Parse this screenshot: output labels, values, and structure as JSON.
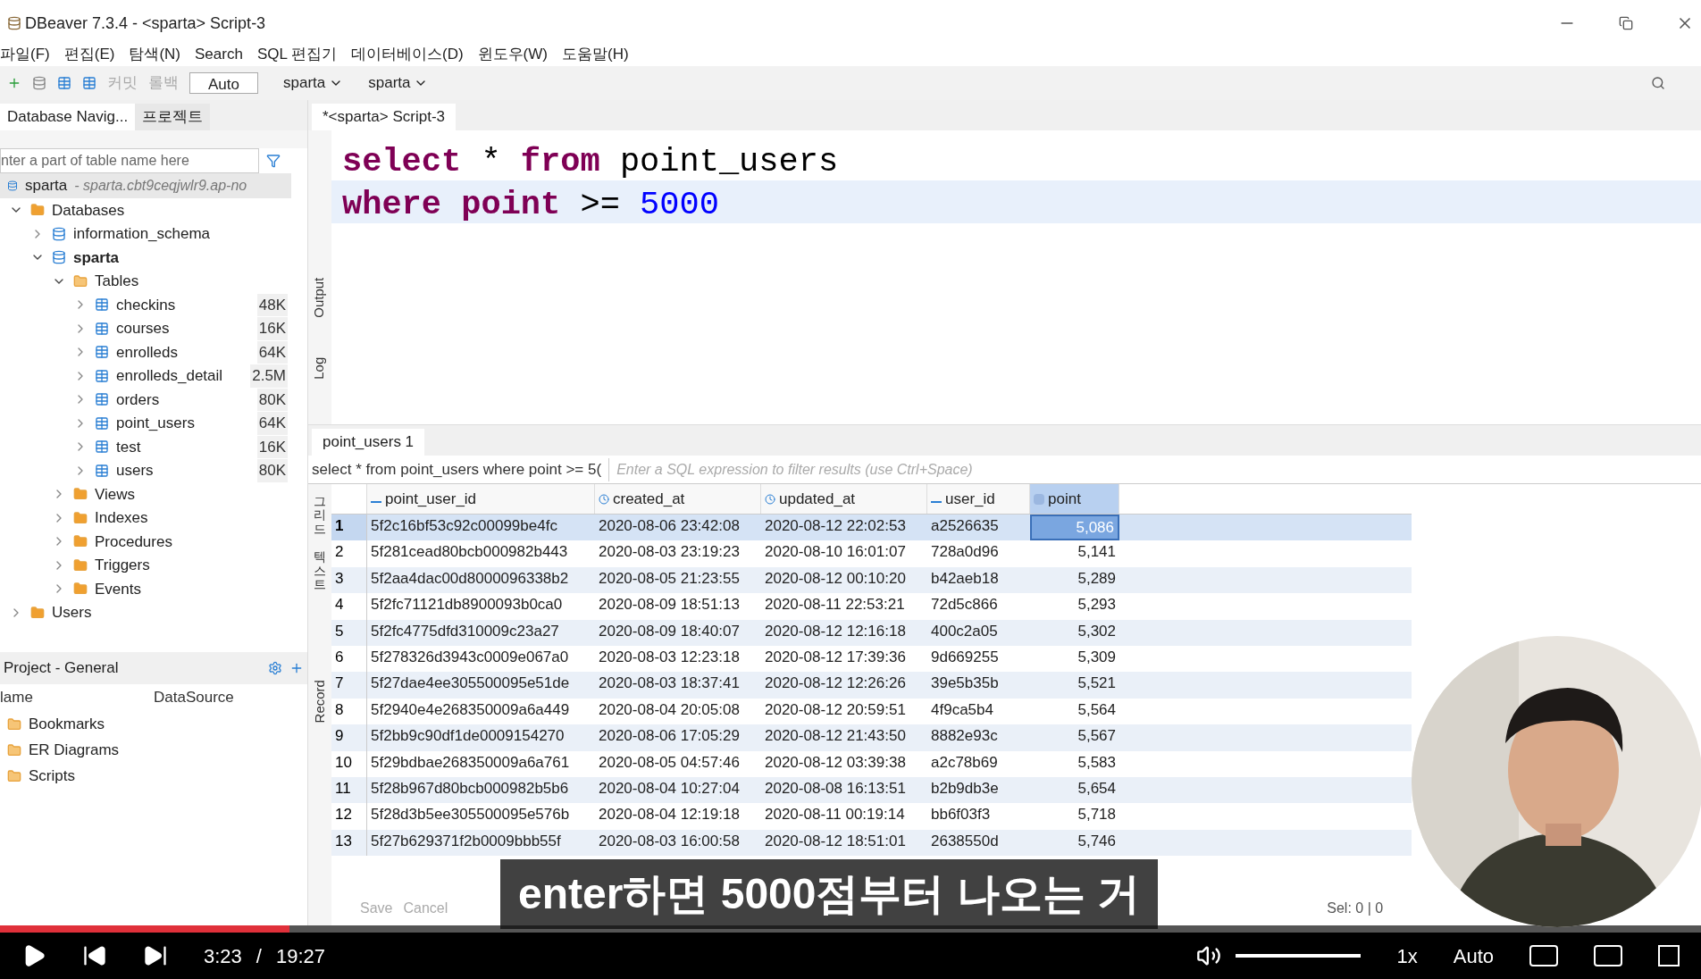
{
  "window": {
    "title": "DBeaver 7.3.4 - <sparta> Script-3"
  },
  "menu": [
    "파일(F)",
    "편집(E)",
    "탐색(N)",
    "Search",
    "SQL 편집기",
    "데이터베이스(D)",
    "윈도우(W)",
    "도움말(H)"
  ],
  "toolbar": {
    "commit": "커밋",
    "rollback": "롤백",
    "transaction_mode": "Auto",
    "datasource": "sparta",
    "schema": "sparta"
  },
  "navigator": {
    "tabs": [
      {
        "label": "Database Navig...",
        "selected": true
      },
      {
        "label": "프로젝트",
        "selected": false
      }
    ],
    "filter_placeholder": "nter a part of table name here",
    "connection": {
      "name": "sparta",
      "host": "- sparta.cbt9ceqjwlr9.ap-no"
    },
    "tree": [
      {
        "label": "Databases",
        "kind": "folder",
        "expanded": true,
        "children": [
          {
            "label": "information_schema",
            "kind": "db",
            "expanded": false
          },
          {
            "label": "sparta",
            "kind": "db",
            "expanded": true,
            "bold": true,
            "children": [
              {
                "label": "Tables",
                "kind": "tables",
                "expanded": true,
                "children": [
                  {
                    "label": "checkins",
                    "kind": "table",
                    "size": "48K",
                    "expanded": false
                  },
                  {
                    "label": "courses",
                    "kind": "table",
                    "size": "16K",
                    "expanded": false
                  },
                  {
                    "label": "enrolleds",
                    "kind": "table",
                    "size": "64K",
                    "expanded": false
                  },
                  {
                    "label": "enrolleds_detail",
                    "kind": "table",
                    "size": "2.5M",
                    "expanded": false
                  },
                  {
                    "label": "orders",
                    "kind": "table",
                    "size": "80K",
                    "expanded": false
                  },
                  {
                    "label": "point_users",
                    "kind": "table",
                    "size": "64K",
                    "expanded": false
                  },
                  {
                    "label": "test",
                    "kind": "table",
                    "size": "16K",
                    "expanded": false
                  },
                  {
                    "label": "users",
                    "kind": "table",
                    "size": "80K",
                    "expanded": false
                  }
                ]
              },
              {
                "label": "Views",
                "kind": "folder",
                "expanded": false
              },
              {
                "label": "Indexes",
                "kind": "folder",
                "expanded": false
              },
              {
                "label": "Procedures",
                "kind": "folder",
                "expanded": false
              },
              {
                "label": "Triggers",
                "kind": "folder",
                "expanded": false
              },
              {
                "label": "Events",
                "kind": "folder",
                "expanded": false
              }
            ]
          }
        ]
      },
      {
        "label": "Users",
        "kind": "folder",
        "expanded": false
      }
    ]
  },
  "project": {
    "title": "Project - General",
    "columns": [
      "lame",
      "DataSource"
    ],
    "items": [
      "Bookmarks",
      "ER Diagrams",
      "Scripts"
    ]
  },
  "editor": {
    "tab": "*<sparta> Script-3",
    "side_tabs": [
      "Output",
      "Log"
    ],
    "lines": [
      {
        "current": false,
        "tokens": [
          {
            "kind": "keyword",
            "text": "select"
          },
          {
            "kind": "plain",
            "text": " * "
          },
          {
            "kind": "keyword",
            "text": "from"
          },
          {
            "kind": "plain",
            "text": " point_users"
          }
        ]
      },
      {
        "current": true,
        "tokens": [
          {
            "kind": "keyword",
            "text": "where point"
          },
          {
            "kind": "plain",
            "text": " >= "
          },
          {
            "kind": "number",
            "text": "5000"
          }
        ]
      }
    ]
  },
  "results": {
    "tab": "point_users 1",
    "query": "select * from point_users where point >= 5(",
    "filter_placeholder": "Enter a SQL expression to filter results (use Ctrl+Space)",
    "side_tabs": [
      "그리드",
      "텍스트",
      "Record"
    ],
    "columns": [
      {
        "name": "point_user_id",
        "kind": "text",
        "selected": false
      },
      {
        "name": "created_at",
        "kind": "time",
        "selected": false
      },
      {
        "name": "updated_at",
        "kind": "time",
        "selected": false
      },
      {
        "name": "user_id",
        "kind": "text",
        "selected": false
      },
      {
        "name": "point",
        "kind": "number",
        "selected": true
      }
    ],
    "rows": [
      {
        "n": "1",
        "selected": true,
        "cells": [
          "5f2c16bf53c92c00099be4fc",
          "2020-08-06 23:42:08",
          "2020-08-12 22:02:53",
          "a2526635",
          "5,086"
        ]
      },
      {
        "n": "2",
        "selected": false,
        "cells": [
          "5f281cead80bcb000982b443",
          "2020-08-03 23:19:23",
          "2020-08-10 16:01:07",
          "728a0d96",
          "5,141"
        ]
      },
      {
        "n": "3",
        "selected": false,
        "cells": [
          "5f2aa4dac00d8000096338b2",
          "2020-08-05 21:23:55",
          "2020-08-12 00:10:20",
          "b42aeb18",
          "5,289"
        ]
      },
      {
        "n": "4",
        "selected": false,
        "cells": [
          "5f2fc71121db8900093b0ca0",
          "2020-08-09 18:51:13",
          "2020-08-11 22:53:21",
          "72d5c866",
          "5,293"
        ]
      },
      {
        "n": "5",
        "selected": false,
        "cells": [
          "5f2fc4775dfd310009c23a27",
          "2020-08-09 18:40:07",
          "2020-08-12 12:16:18",
          "400c2a05",
          "5,302"
        ]
      },
      {
        "n": "6",
        "selected": false,
        "cells": [
          "5f278326d3943c0009e067a0",
          "2020-08-03 12:23:18",
          "2020-08-12 17:39:36",
          "9d669255",
          "5,309"
        ]
      },
      {
        "n": "7",
        "selected": false,
        "cells": [
          "5f27dae4ee305500095e51de",
          "2020-08-03 18:37:41",
          "2020-08-12 12:26:26",
          "39e5b35b",
          "5,521"
        ]
      },
      {
        "n": "8",
        "selected": false,
        "cells": [
          "5f2940e4e268350009a6a449",
          "2020-08-04 20:05:08",
          "2020-08-12 20:59:51",
          "4f9ca5b4",
          "5,564"
        ]
      },
      {
        "n": "9",
        "selected": false,
        "cells": [
          "5f2bb9c90df1de0009154270",
          "2020-08-06 17:05:29",
          "2020-08-12 21:43:50",
          "8882e93c",
          "5,567"
        ]
      },
      {
        "n": "10",
        "selected": false,
        "cells": [
          "5f29bdbae268350009a6a761",
          "2020-08-05 04:57:46",
          "2020-08-12 03:39:38",
          "a2c78b69",
          "5,583"
        ]
      },
      {
        "n": "11",
        "selected": false,
        "cells": [
          "5f28b967d80bcb000982b5b6",
          "2020-08-04 10:27:04",
          "2020-08-08 16:13:51",
          "b2b9db3e",
          "5,654"
        ]
      },
      {
        "n": "12",
        "selected": false,
        "cells": [
          "5f28d3b5ee305500095e576b",
          "2020-08-04 12:19:18",
          "2020-08-11 00:19:14",
          "bb6f03f3",
          "5,718"
        ]
      },
      {
        "n": "13",
        "selected": false,
        "cells": [
          "5f27b629371f2b0009bbb55f",
          "2020-08-03 16:00:58",
          "2020-08-12 18:51:01",
          "2638550d",
          "5,746"
        ]
      }
    ],
    "actions": [
      {
        "label": "Save",
        "disabled": true
      },
      {
        "label": "Cancel",
        "disabled": true
      }
    ],
    "selection": "Sel: 0 | 0"
  },
  "player": {
    "current_time": "3:23",
    "separator": "/",
    "duration": "19:27",
    "progress": {
      "level": 0.17
    },
    "volume": {
      "level": 1
    },
    "speed": "1x",
    "quality": "Auto",
    "caption": "enter하면 5000점부터 나오는 거"
  }
}
